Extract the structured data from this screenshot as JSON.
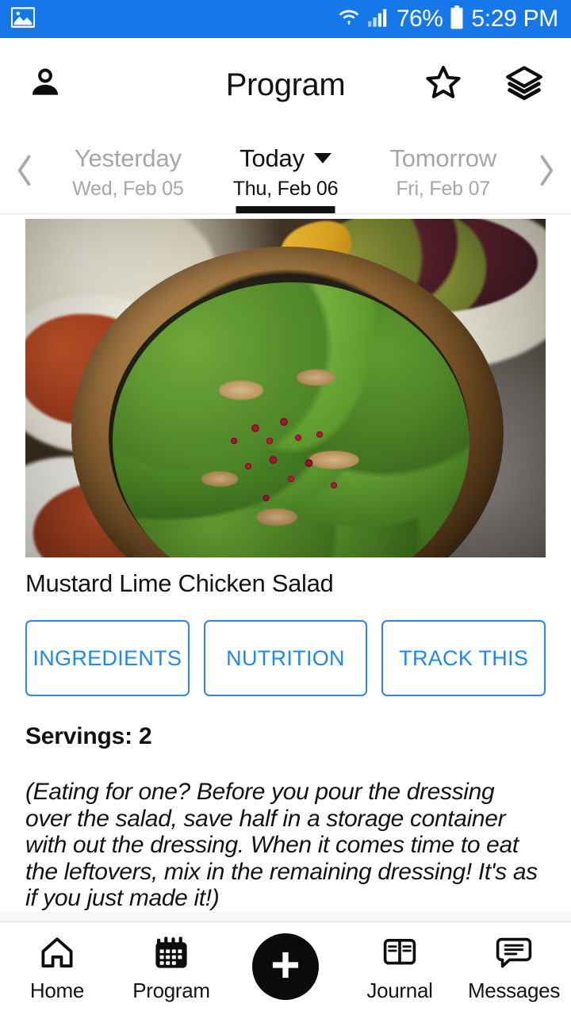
{
  "status_bar": {
    "left_icon": "image-icon",
    "wifi_icon": "wifi-icon",
    "signal_icon": "cell-signal-icon",
    "battery_percent": "76%",
    "battery_icon": "battery-icon",
    "clock": "5:29 PM",
    "background_color": "#1678e8",
    "text_color": "#ffffff"
  },
  "app_bar": {
    "profile_icon": "person-icon",
    "title": "Program",
    "favorite_icon": "star-outline-icon",
    "layers_icon": "layers-icon"
  },
  "date_bar": {
    "prev_arrow": "chevron-left-icon",
    "next_arrow": "chevron-right-icon",
    "tabs": [
      {
        "main": "Yesterday",
        "sub": "Wed, Feb 05",
        "active": false,
        "has_caret": false
      },
      {
        "main": "Today",
        "sub": "Thu, Feb 06",
        "active": true,
        "has_caret": true
      },
      {
        "main": "Tomorrow",
        "sub": "Fri, Feb 07",
        "active": false,
        "has_caret": false
      }
    ]
  },
  "meal": {
    "photo_alt": "salad-photo",
    "title": "Mustard Lime Chicken Salad",
    "actions": [
      {
        "label": "INGREDIENTS"
      },
      {
        "label": "NUTRITION"
      },
      {
        "label": "TRACK THIS"
      }
    ],
    "servings": "Servings: 2",
    "note": "(Eating for one? Before you pour the dressing over the salad, save half in a storage container with out the dressing. When it comes time to eat the leftovers, mix in the remaining dressing! It's as if you just made it!)"
  },
  "bottom_nav": {
    "items": [
      {
        "label": "Home",
        "icon": "home-icon",
        "active": false
      },
      {
        "label": "Program",
        "icon": "calendar-icon",
        "active": true
      },
      {
        "label": "",
        "icon": "plus-icon",
        "active": false
      },
      {
        "label": "Journal",
        "icon": "book-icon",
        "active": false
      },
      {
        "label": "Messages",
        "icon": "message-bubble-icon",
        "active": false
      }
    ],
    "fab_icon": "plus-icon"
  },
  "colors": {
    "accent_blue": "#2288e8",
    "status_bar_blue": "#1678e8",
    "active_text": "#101010",
    "inactive_text": "#a6a6a6"
  }
}
